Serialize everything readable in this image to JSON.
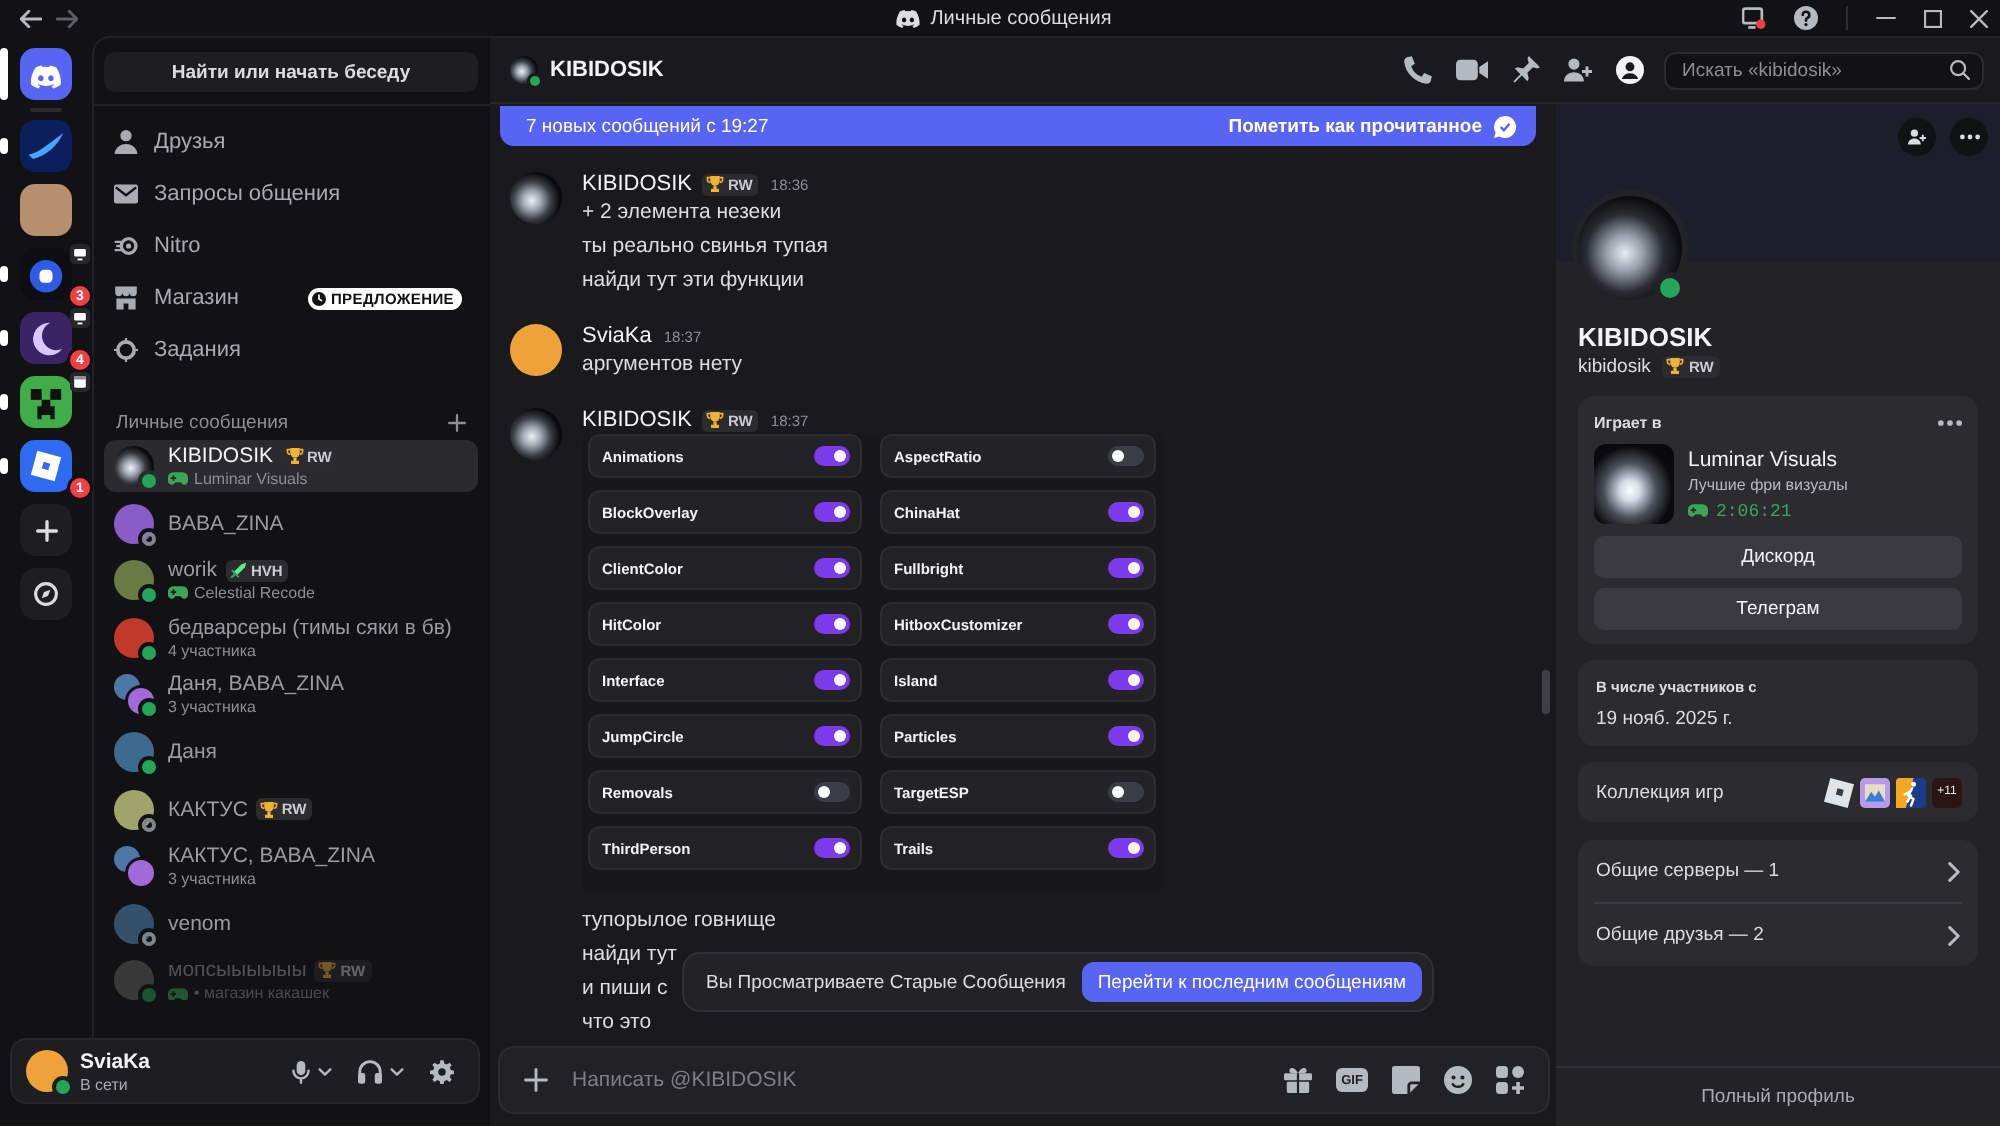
{
  "titlebar": {
    "title": "Личные сообщения"
  },
  "servers": [
    {
      "kind": "home",
      "selected": true,
      "streaming": false,
      "event": false
    },
    {
      "kind": "server",
      "selected": false,
      "unread": true,
      "streaming": false,
      "event": false
    },
    {
      "kind": "server",
      "selected": false,
      "unread": false,
      "streaming": false,
      "event": false
    },
    {
      "kind": "server",
      "selected": false,
      "unread": true,
      "mentions": "3",
      "streaming": true,
      "event": false
    },
    {
      "kind": "server",
      "selected": false,
      "unread": true,
      "mentions": "4",
      "streaming": true,
      "event": false
    },
    {
      "kind": "server",
      "selected": false,
      "unread": true,
      "streaming": false,
      "event": true
    },
    {
      "kind": "server",
      "selected": false,
      "unread": true,
      "mentions": "1",
      "streaming": false,
      "event": false
    }
  ],
  "sidebar": {
    "search": "Найти или начать беседу",
    "nav": [
      {
        "label": "Друзья",
        "selected": false
      },
      {
        "label": "Запросы общения",
        "selected": false
      },
      {
        "label": "Nitro",
        "selected": false
      },
      {
        "label": "Магазин",
        "selected": false,
        "badge": "ПРЕДЛОЖЕНИЕ"
      },
      {
        "label": "Задания",
        "selected": false
      }
    ],
    "dm_title": "Личные сообщения",
    "dms": [
      {
        "kind": "direct",
        "name": "KIBIDOSIK",
        "online": true,
        "tag": {
          "kind": "trophy",
          "text": "RW"
        },
        "activity": "Luminar Visuals",
        "selected": true,
        "dimmed": false
      },
      {
        "kind": "direct",
        "name": "BABA_ZINA",
        "online": false,
        "selected": false,
        "dimmed": false
      },
      {
        "kind": "direct",
        "name": "worik",
        "online": true,
        "tag": {
          "kind": "sword",
          "text": "HVH"
        },
        "activity": "Celestial Recode",
        "selected": false,
        "dimmed": false
      },
      {
        "kind": "group",
        "name": "бедварсеры (тимы сяки в бв)",
        "members": "4 участника",
        "online": true,
        "selected": false,
        "dimmed": false
      },
      {
        "kind": "pair",
        "name": "Даня, BABA_ZINA",
        "members": "3 участника",
        "online": true,
        "selected": false,
        "dimmed": false
      },
      {
        "kind": "direct",
        "name": "Даня",
        "online": true,
        "selected": false,
        "dimmed": false
      },
      {
        "kind": "direct",
        "name": "КАКТУС",
        "online": false,
        "tag": {
          "kind": "trophy",
          "text": "RW"
        },
        "selected": false,
        "dimmed": false
      },
      {
        "kind": "pair",
        "name": "КАКТУС, BABA_ZINA",
        "members": "3 участника",
        "selected": false,
        "dimmed": false
      },
      {
        "kind": "direct",
        "name": "venom",
        "online": false,
        "selected": false,
        "dimmed": false
      },
      {
        "kind": "direct",
        "name": "мопсыыыыыы",
        "online": true,
        "tag": {
          "kind": "trophy",
          "text": "RW"
        },
        "activity": "• магазин какашек",
        "selected": false,
        "dimmed": true
      }
    ]
  },
  "user_panel": {
    "name": "SviaKa",
    "status_text": "В сети",
    "online": true
  },
  "chat": {
    "header": {
      "name": "KIBIDOSIK",
      "online": true,
      "search_placeholder": "Искать «kibidosik»",
      "profile_open": true
    },
    "new_messages": {
      "text": "7 новых сообщений с 19:27",
      "action": "Пометить как прочитанное"
    },
    "messages": [
      {
        "author": "KIBIDOSIK",
        "tag": {
          "kind": "trophy",
          "text": "RW"
        },
        "time": "18:36",
        "lines": [
          "+ 2 элемента незеки",
          "ты реально свинья тупая",
          "найди тут эти функции"
        ]
      },
      {
        "author": "SviaKa",
        "time": "18:37",
        "lines": [
          "аргументов нету"
        ]
      },
      {
        "author": "KIBIDOSIK",
        "tag": {
          "kind": "trophy",
          "text": "RW"
        },
        "time": "18:37",
        "attachment": {
          "toggles": [
            {
              "label": "Animations",
              "on": true
            },
            {
              "label": "AspectRatio",
              "on": false
            },
            {
              "label": "BlockOverlay",
              "on": true
            },
            {
              "label": "ChinaHat",
              "on": true
            },
            {
              "label": "ClientColor",
              "on": true
            },
            {
              "label": "Fullbright",
              "on": true
            },
            {
              "label": "HitColor",
              "on": true
            },
            {
              "label": "HitboxCustomizer",
              "on": true
            },
            {
              "label": "Interface",
              "on": true
            },
            {
              "label": "Island",
              "on": true
            },
            {
              "label": "JumpCircle",
              "on": true
            },
            {
              "label": "Particles",
              "on": true
            },
            {
              "label": "Removals",
              "on": false
            },
            {
              "label": "TargetESP",
              "on": false
            },
            {
              "label": "ThirdPerson",
              "on": true
            },
            {
              "label": "Trails",
              "on": true
            }
          ]
        },
        "lines": [
          "тупорылое говнище",
          "найди тут",
          "и пиши с",
          "что это"
        ]
      }
    ],
    "jump": {
      "text": "Вы Просматриваете Старые Сообщения",
      "button": "Перейти к последним сообщениям"
    },
    "composer": {
      "placeholder": "Написать @KIBIDOSIK",
      "gif_label": "GIF"
    }
  },
  "profile": {
    "display_name": "KIBIDOSIK",
    "username": "kibidosik",
    "online": true,
    "tag": {
      "kind": "trophy",
      "text": "RW"
    },
    "activity": {
      "heading": "Играет в",
      "name": "Luminar Visuals",
      "details": "Лучшие фри визуалы",
      "elapsed": "2:06:21",
      "buttons": [
        "Дискорд",
        "Телеграм"
      ]
    },
    "member_since": {
      "label": "В числе участников с",
      "date": "19 нояб. 2025 г."
    },
    "games": {
      "label": "Коллекция игр",
      "more": "+11"
    },
    "mutuals": [
      "Общие серверы — 1",
      "Общие друзья — 2"
    ],
    "footer": "Полный профиль"
  }
}
